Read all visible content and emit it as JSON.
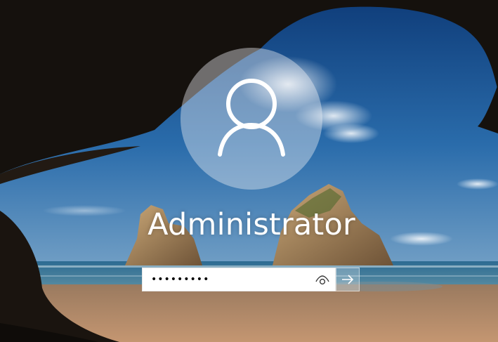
{
  "user": {
    "name": "Administrator"
  },
  "password": {
    "masked_value": "•••••••••",
    "reveal_icon": "eye-icon"
  },
  "submit": {
    "icon": "arrow-right-icon"
  },
  "avatar": {
    "icon": "user-icon"
  },
  "colors": {
    "sky": "#1f5a96",
    "sea": "#2e6f8e",
    "sand": "#b58a67",
    "cave": "#17130f"
  }
}
